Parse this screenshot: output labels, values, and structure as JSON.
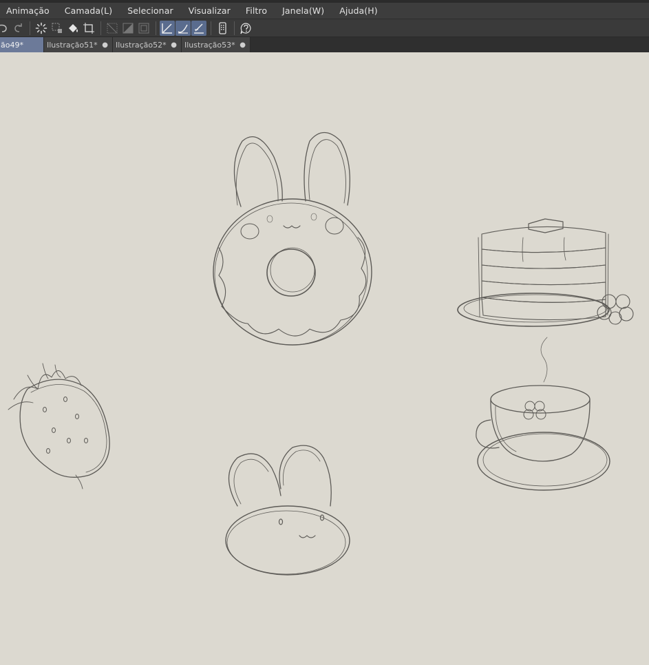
{
  "menubar": {
    "items": [
      "Animação",
      "Camada(L)",
      "Selecionar",
      "Visualizar",
      "Filtro",
      "Janela(W)",
      "Ajuda(H)"
    ]
  },
  "toolbar": {
    "icons": [
      "undo-icon",
      "redo-icon",
      "loading-icon",
      "select-transform-icon",
      "fill-icon",
      "crop-icon",
      "ruler-snap-icon",
      "special-ruler-snap-icon",
      "grid-snap-icon",
      "snap-ruler-active-icon",
      "snap-special-ruler-active-icon",
      "snap-grid-active-icon",
      "smartphone-icon",
      "help-icon"
    ]
  },
  "tabs": [
    {
      "label": "ão49*",
      "active": true
    },
    {
      "label": "Ilustração51*",
      "active": false
    },
    {
      "label": "Ilustração52*",
      "active": false
    },
    {
      "label": "Ilustração53*",
      "active": false
    }
  ],
  "tab_close_glyph": "●",
  "colors": {
    "menubar_bg": "#3d3d3d",
    "toolbar_active": "#5a6c8e",
    "active_tab": "#6c7a99",
    "canvas_paper": "#dcd9d0",
    "sketch_stroke": "#5c5a56"
  },
  "canvas": {
    "sketches": [
      "bunny-donut",
      "pancake-stack",
      "strawberry",
      "bunny-mochi",
      "teacup"
    ]
  }
}
